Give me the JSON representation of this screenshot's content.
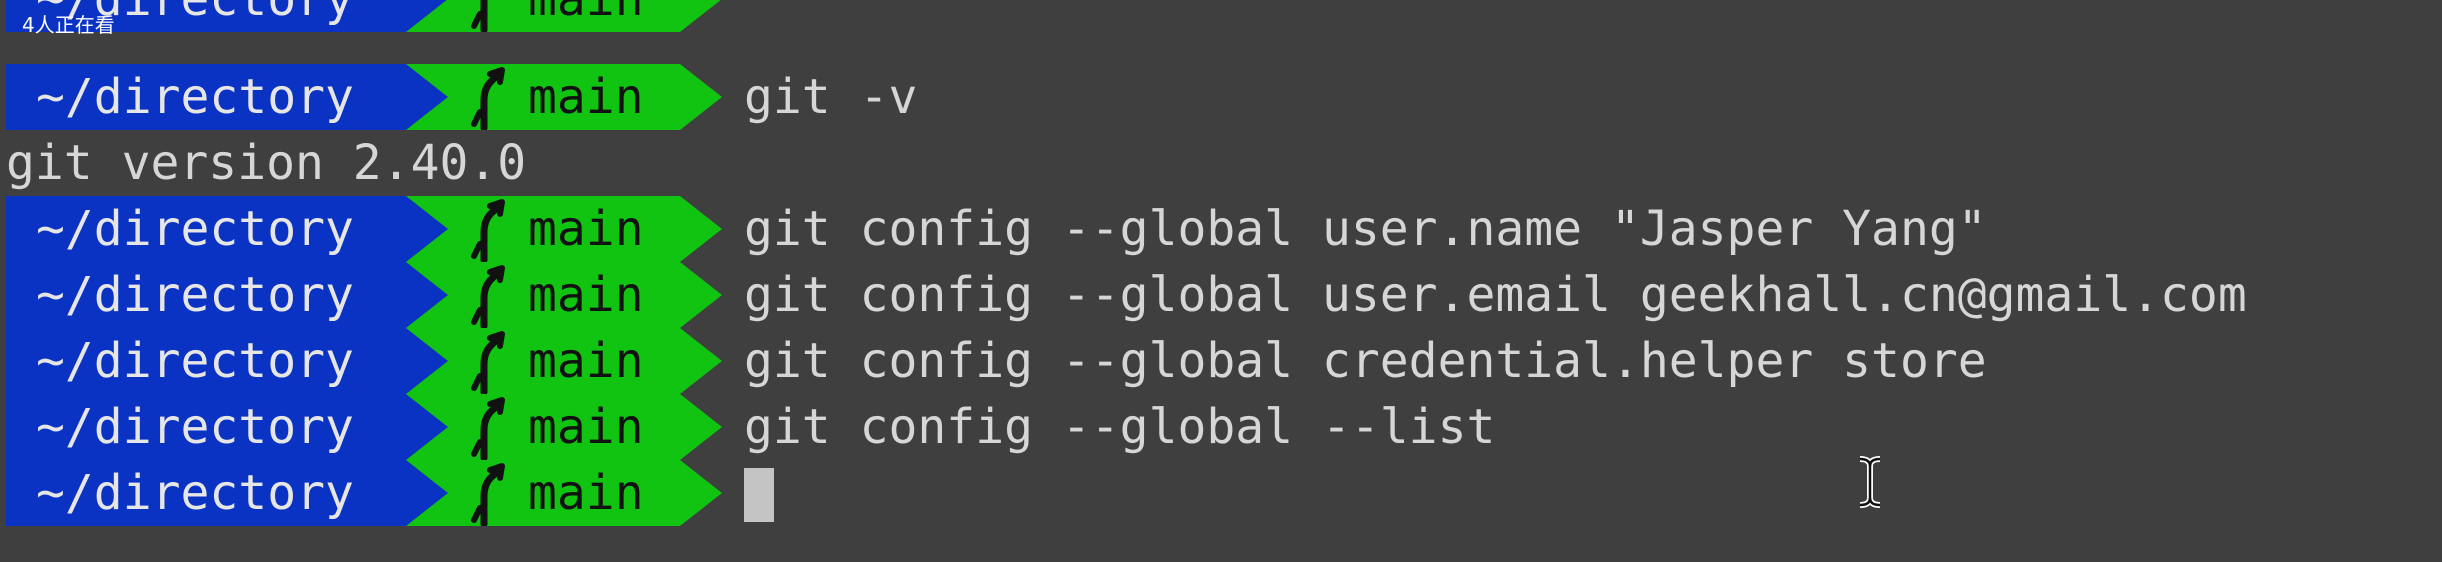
{
  "overlay": {
    "viewer_count": "4人正在看"
  },
  "prompt": {
    "directory": "~/directory",
    "branch": "main",
    "directory_color": "#0a33c4",
    "branch_color": "#11c411",
    "branch_icon": "git-branch-icon"
  },
  "lines": [
    {
      "type": "prompt",
      "command": ""
    },
    {
      "type": "prompt",
      "command": "git -v"
    },
    {
      "type": "output",
      "text": "git version 2.40.0"
    },
    {
      "type": "prompt",
      "command": "git config --global user.name \"Jasper Yang\""
    },
    {
      "type": "prompt",
      "command": "git config --global user.email geekhall.cn@gmail.com"
    },
    {
      "type": "prompt",
      "command": "git config --global credential.helper store"
    },
    {
      "type": "prompt",
      "command": "git config --global --list"
    },
    {
      "type": "prompt",
      "command": "",
      "cursor": true
    }
  ],
  "colors": {
    "background": "#3f3f3f",
    "foreground": "#d6d6d6",
    "cursor": "#c4c4c4"
  }
}
